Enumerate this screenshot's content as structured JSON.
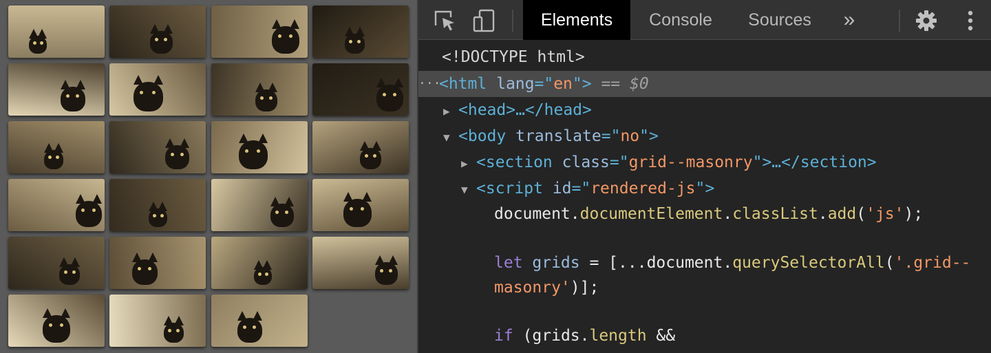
{
  "grid": {
    "tiles": [
      {
        "name": "cat-field"
      },
      {
        "name": "black-cat-doorway"
      },
      {
        "name": "fluffy-cat-face"
      },
      {
        "name": "black-cat-dark"
      },
      {
        "name": "black-cat-crouch"
      },
      {
        "name": "cat-window"
      },
      {
        "name": "cat-looking-up"
      },
      {
        "name": "black-cat-closeup"
      },
      {
        "name": "cat-face-closeup"
      },
      {
        "name": "black-cat-garden"
      },
      {
        "name": "cat-sitting-room"
      },
      {
        "name": "cat-by-window"
      },
      {
        "name": "cat-lying-white"
      },
      {
        "name": "cat-dark-corner"
      },
      {
        "name": "black-cat-resting"
      },
      {
        "name": "cat-tree-trunk"
      },
      {
        "name": "cat-profile"
      },
      {
        "name": "longhair-cat-lying"
      },
      {
        "name": "black-cat-stump"
      },
      {
        "name": "black-cat-portrait"
      },
      {
        "name": "black-cat-branches"
      },
      {
        "name": "cat-silhouette"
      },
      {
        "name": "cat-grass"
      }
    ]
  },
  "devtools": {
    "tabs": {
      "elements": "Elements",
      "console": "Console",
      "sources": "Sources",
      "more": "»"
    },
    "code": {
      "doctype": "<!DOCTYPE html>",
      "html_open": "<html",
      "html_attr": " lang",
      "html_eq": "=\"",
      "html_val": "en",
      "html_close": "\">",
      "html_marker": " == $0",
      "head": "<head>…</head>",
      "body_open": "<body",
      "body_attr": " translate",
      "body_eq": "=\"",
      "body_val": "no",
      "body_close": "\">",
      "section_open": "<section",
      "section_attr": " class",
      "section_eq": "=\"",
      "section_val": "grid--masonry",
      "section_close": "\">…</section>",
      "script_open": "<script",
      "script_attr": " id",
      "script_eq": "=\"",
      "script_val": "rendered-js",
      "script_close": "\">",
      "js1_a": "document.",
      "js1_b": "documentElement",
      "js1_c": ".",
      "js1_d": "classList",
      "js1_e": ".",
      "js1_f": "add",
      "js1_g": "(",
      "js1_h": "'js'",
      "js1_i": ");",
      "js2_kw": "let",
      "js2_a": " grids",
      "js2_b": " = [...document.",
      "js2_c": "querySelectorAll",
      "js2_d": "(",
      "js2_e": "'.grid--",
      "js3_a": "masonry'",
      "js3_b": ")];",
      "js4_kw": "if",
      "js4_a": " (grids.",
      "js4_b": "length",
      "js4_c": " &&"
    }
  },
  "colors": {
    "tag": "#5db0d7",
    "attr": "#9bbbdc",
    "value": "#f29766",
    "keyword": "#9a7fd5",
    "function": "#d9c97c"
  },
  "icons": [
    "inspect-element-icon",
    "device-toolbar-icon",
    "more-tabs-icon",
    "settings-gear-icon",
    "kebab-menu-icon"
  ]
}
